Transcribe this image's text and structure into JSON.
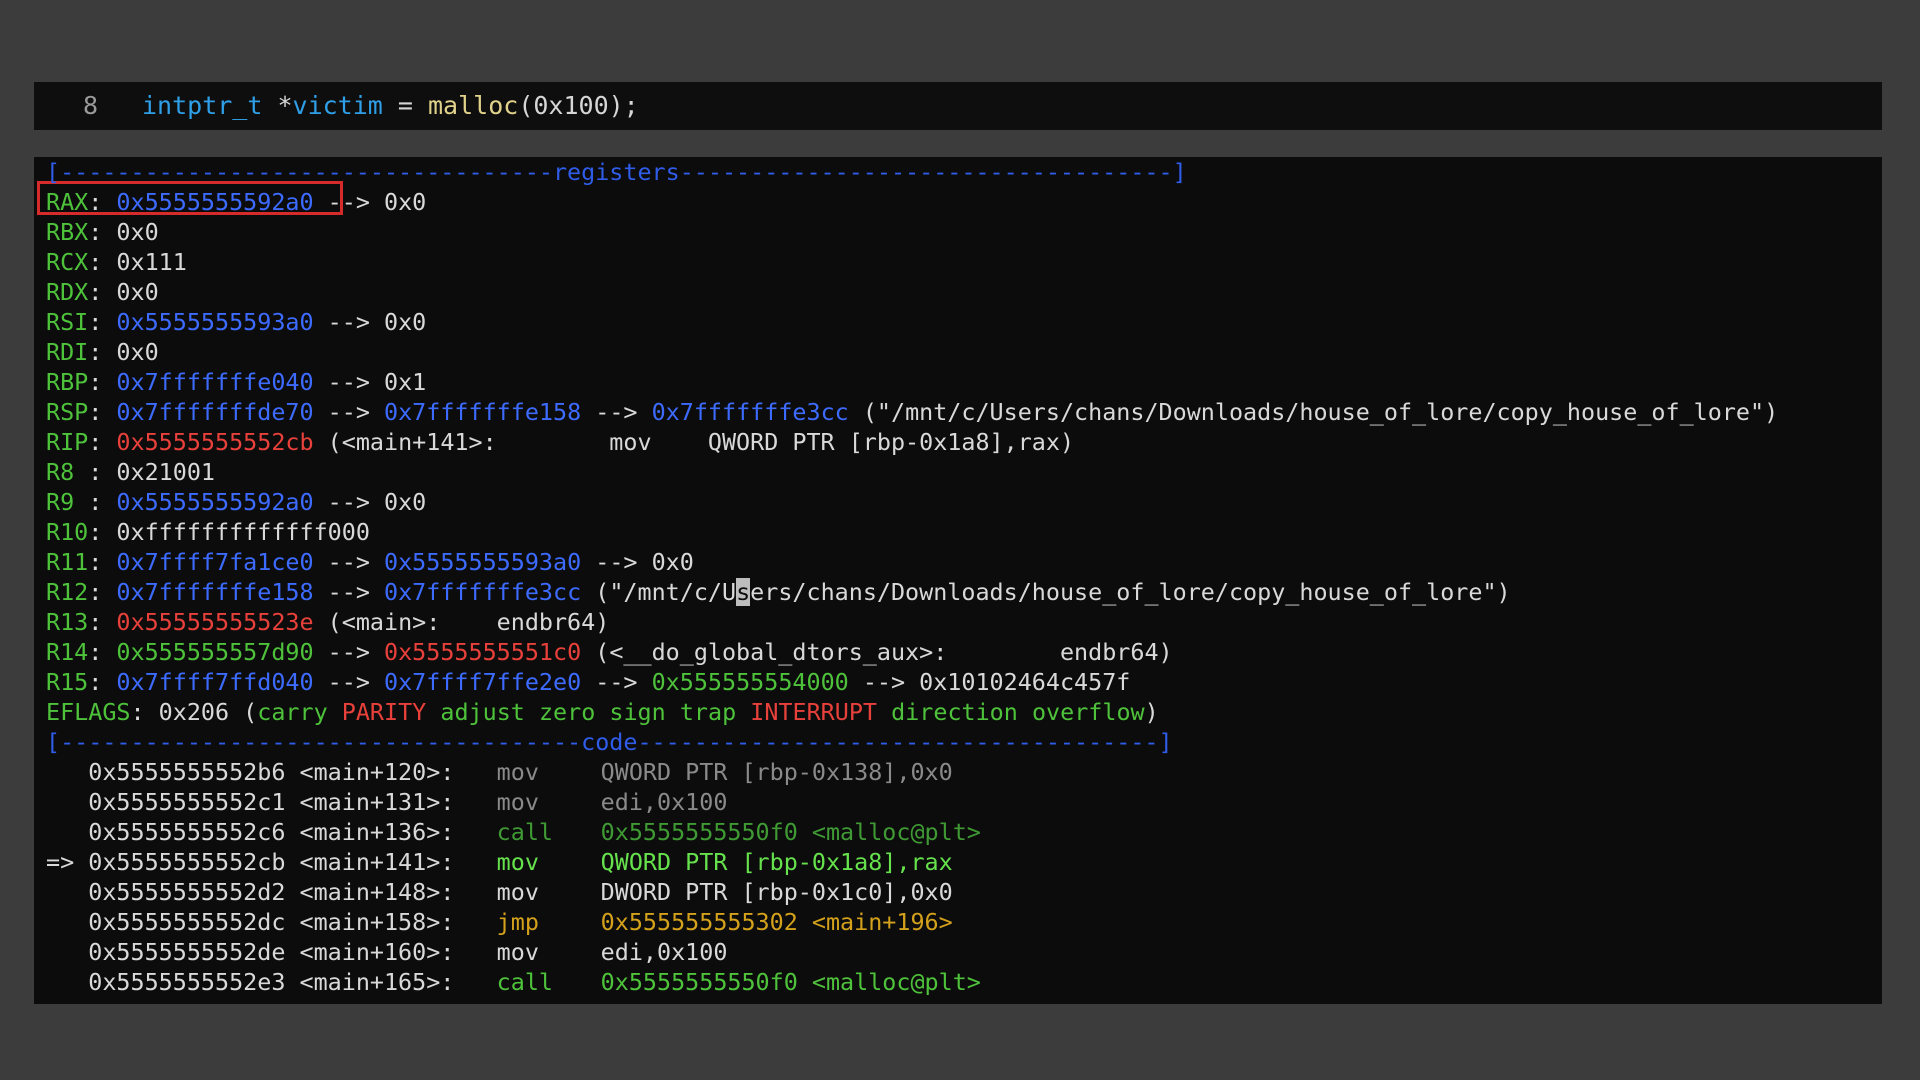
{
  "source": {
    "line_number": "8",
    "type": "intptr_t",
    "rest": " *",
    "var": "victim",
    "op": " = ",
    "func": "malloc",
    "args": "(0x100);"
  },
  "sections": {
    "registers_header": "[-----------------------------------registers-----------------------------------]",
    "code_header": "[-------------------------------------code-------------------------------------]"
  },
  "registers": {
    "rax": {
      "name": "RAX",
      "val": "0x5555555592a0",
      "rest": " --> 0x0"
    },
    "rbx": {
      "name": "RBX",
      "val": "0x0"
    },
    "rcx": {
      "name": "RCX",
      "val": "0x111"
    },
    "rdx": {
      "name": "RDX",
      "val": "0x0"
    },
    "rsi": {
      "name": "RSI",
      "val": "0x5555555593a0",
      "rest": " --> 0x0"
    },
    "rdi": {
      "name": "RDI",
      "val": "0x0"
    },
    "rbp": {
      "name": "RBP",
      "val": "0x7fffffffe040",
      "rest": " --> 0x1"
    },
    "rsp": {
      "name": "RSP",
      "val": "0x7fffffffde70",
      "arrow1": " --> ",
      "val2": "0x7fffffffe158",
      "arrow2": " --> ",
      "val3": "0x7fffffffe3cc",
      "rest": " (\"/mnt/c/Users/chans/Downloads/house_of_lore/copy_house_of_lore\")"
    },
    "rip": {
      "name": "RIP",
      "val": "0x5555555552cb",
      "rest": " (<main+141>:        mov    QWORD PTR [rbp-0x1a8],rax)"
    },
    "r8": {
      "name": "R8 ",
      "val": "0x21001"
    },
    "r9": {
      "name": "R9 ",
      "val": "0x5555555592a0",
      "rest": " --> 0x0"
    },
    "r10": {
      "name": "R10",
      "val": "0xfffffffffffff000"
    },
    "r11": {
      "name": "R11",
      "val": "0x7ffff7fa1ce0",
      "arrow1": " --> ",
      "val2": "0x5555555593a0",
      "rest": " --> 0x0"
    },
    "r12": {
      "name": "R12",
      "val": "0x7fffffffe158",
      "arrow1": " --> ",
      "val2": "0x7fffffffe3cc",
      "pre": " (\"/mnt/c/U",
      "cur": "s",
      "post": "ers/chans/Downloads/house_of_lore/copy_house_of_lore\")"
    },
    "r13": {
      "name": "R13",
      "val": "0x55555555523e",
      "rest": " (<main>:    endbr64)"
    },
    "r14": {
      "name": "R14",
      "val": "0x555555557d90",
      "arrow1": " --> ",
      "val2": "0x5555555551c0",
      "rest": " (<__do_global_dtors_aux>:        endbr64)"
    },
    "r15": {
      "name": "R15",
      "val": "0x7ffff7ffd040",
      "arrow1": " --> ",
      "val2": "0x7ffff7ffe2e0",
      "arrow2": " --> ",
      "val3": "0x555555554000",
      "rest": " --> 0x10102464c457f"
    },
    "eflags": {
      "name": "EFLAGS",
      "val": ": 0x206 (",
      "carry": "carry",
      "parity": "PARITY",
      "adjust": "adjust",
      "zero": "zero",
      "sign": "sign",
      "trap": "trap",
      "interrupt": "INTERRUPT",
      "direction": "direction",
      "overflow": "overflow",
      "close": ")"
    }
  },
  "code": [
    {
      "prefix": "   ",
      "addr": "0x5555555552b6 <main+120>:",
      "op": "mov",
      "args": "QWORD PTR [rbp-0x138],0x0"
    },
    {
      "prefix": "   ",
      "addr": "0x5555555552c1 <main+131>:",
      "op": "mov",
      "args": "edi,0x100"
    },
    {
      "prefix": "   ",
      "addr": "0x5555555552c6 <main+136>:",
      "op": "call",
      "args": "0x5555555550f0 <malloc@plt>"
    },
    {
      "prefix": "=> ",
      "addr": "0x5555555552cb <main+141>:",
      "op": "mov",
      "args": "QWORD PTR [rbp-0x1a8],rax"
    },
    {
      "prefix": "   ",
      "addr": "0x5555555552d2 <main+148>:",
      "op": "mov",
      "args": "DWORD PTR [rbp-0x1c0],0x0"
    },
    {
      "prefix": "   ",
      "addr": "0x5555555552dc <main+158>:",
      "op": "jmp",
      "args": "0x555555555302 <main+196>"
    },
    {
      "prefix": "   ",
      "addr": "0x5555555552de <main+160>:",
      "op": "mov",
      "args": "edi,0x100"
    },
    {
      "prefix": "   ",
      "addr": "0x5555555552e3 <main+165>:",
      "op": "call",
      "args": "0x5555555550f0 <malloc@plt>"
    }
  ],
  "colors": {
    "background": "#3c3c3c",
    "terminal": "#0c0c0c",
    "register_name": "#4ec23b",
    "pointer": "#3d6bff",
    "code_pointer": "#e8413b",
    "highlight_box": "#d62b2b"
  }
}
